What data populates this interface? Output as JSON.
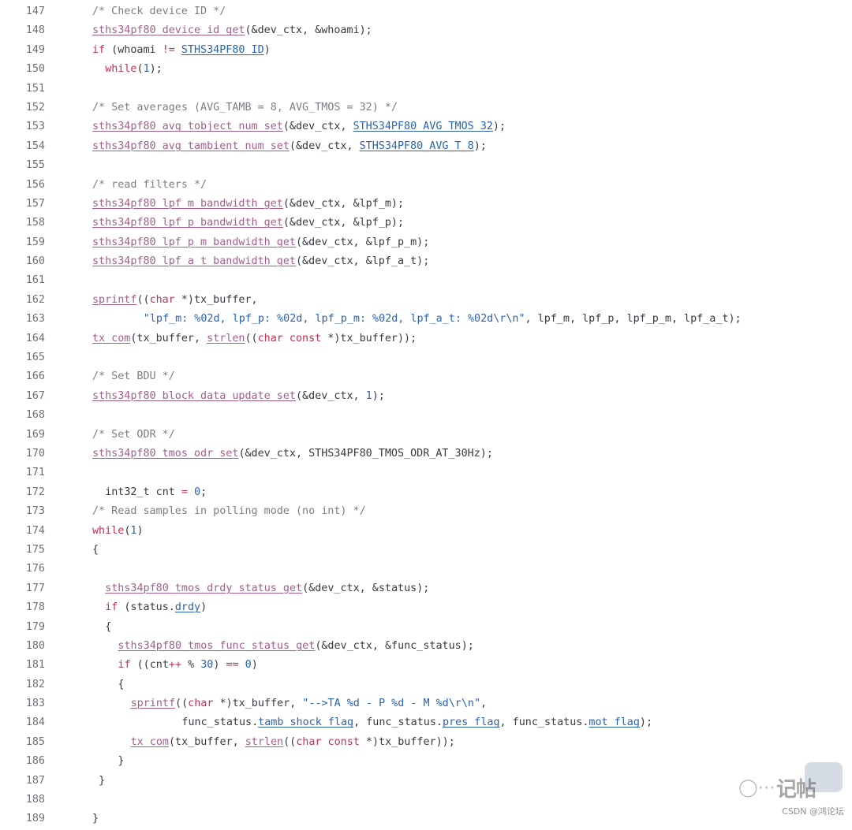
{
  "lines": [
    {
      "n": "147",
      "indent": 0,
      "tokens": [
        {
          "t": "/* Check device ID */",
          "c": "cm"
        }
      ]
    },
    {
      "n": "148",
      "indent": 0,
      "tokens": [
        {
          "t": "sths34pf80_device_id_get",
          "c": "fn"
        },
        {
          "t": "(&dev_ctx, &whoami);",
          "c": "id"
        }
      ]
    },
    {
      "n": "149",
      "indent": 0,
      "tokens": [
        {
          "t": "if",
          "c": "kw"
        },
        {
          "t": " (whoami ",
          "c": "id"
        },
        {
          "t": "!=",
          "c": "kw"
        },
        {
          "t": " ",
          "c": "id"
        },
        {
          "t": "STHS34PF80_ID",
          "c": "mac"
        },
        {
          "t": ")",
          "c": "id"
        }
      ]
    },
    {
      "n": "150",
      "indent": 2,
      "tokens": [
        {
          "t": "while",
          "c": "kw"
        },
        {
          "t": "(",
          "c": "id"
        },
        {
          "t": "1",
          "c": "num"
        },
        {
          "t": ");",
          "c": "id"
        }
      ]
    },
    {
      "n": "151",
      "indent": 0,
      "tokens": []
    },
    {
      "n": "152",
      "indent": 0,
      "tokens": [
        {
          "t": "/* Set averages (AVG_TAMB = 8, AVG_TMOS = 32) */",
          "c": "cm"
        }
      ]
    },
    {
      "n": "153",
      "indent": 0,
      "tokens": [
        {
          "t": "sths34pf80_avg_tobject_num_set",
          "c": "fn"
        },
        {
          "t": "(&dev_ctx, ",
          "c": "id"
        },
        {
          "t": "STHS34PF80_AVG_TMOS_32",
          "c": "mac"
        },
        {
          "t": ");",
          "c": "id"
        }
      ]
    },
    {
      "n": "154",
      "indent": 0,
      "tokens": [
        {
          "t": "sths34pf80_avg_tambient_num_set",
          "c": "fn"
        },
        {
          "t": "(&dev_ctx, ",
          "c": "id"
        },
        {
          "t": "STHS34PF80_AVG_T_8",
          "c": "mac"
        },
        {
          "t": ");",
          "c": "id"
        }
      ]
    },
    {
      "n": "155",
      "indent": 0,
      "tokens": []
    },
    {
      "n": "156",
      "indent": 0,
      "tokens": [
        {
          "t": "/* read filters */",
          "c": "cm"
        }
      ]
    },
    {
      "n": "157",
      "indent": 0,
      "tokens": [
        {
          "t": "sths34pf80_lpf_m_bandwidth_get",
          "c": "fn"
        },
        {
          "t": "(&dev_ctx, &lpf_m);",
          "c": "id"
        }
      ]
    },
    {
      "n": "158",
      "indent": 0,
      "tokens": [
        {
          "t": "sths34pf80_lpf_p_bandwidth_get",
          "c": "fn"
        },
        {
          "t": "(&dev_ctx, &lpf_p);",
          "c": "id"
        }
      ]
    },
    {
      "n": "159",
      "indent": 0,
      "tokens": [
        {
          "t": "sths34pf80_lpf_p_m_bandwidth_get",
          "c": "fn"
        },
        {
          "t": "(&dev_ctx, &lpf_p_m);",
          "c": "id"
        }
      ]
    },
    {
      "n": "160",
      "indent": 0,
      "tokens": [
        {
          "t": "sths34pf80_lpf_a_t_bandwidth_get",
          "c": "fn"
        },
        {
          "t": "(&dev_ctx, &lpf_a_t);",
          "c": "id"
        }
      ]
    },
    {
      "n": "161",
      "indent": 0,
      "tokens": []
    },
    {
      "n": "162",
      "indent": 0,
      "tokens": [
        {
          "t": "sprintf",
          "c": "fn"
        },
        {
          "t": "((",
          "c": "id"
        },
        {
          "t": "char",
          "c": "kw"
        },
        {
          "t": " *)tx_buffer,",
          "c": "id"
        }
      ]
    },
    {
      "n": "163",
      "indent": 8,
      "tokens": [
        {
          "t": "\"lpf_m: %02d, lpf_p: %02d, lpf_p_m: %02d, lpf_a_t: %02d\\r\\n\"",
          "c": "str"
        },
        {
          "t": ", lpf_m, lpf_p, lpf_p_m, lpf_a_t);",
          "c": "id"
        }
      ]
    },
    {
      "n": "164",
      "indent": 0,
      "tokens": [
        {
          "t": "tx_com",
          "c": "fn"
        },
        {
          "t": "(tx_buffer, ",
          "c": "id"
        },
        {
          "t": "strlen",
          "c": "fn"
        },
        {
          "t": "((",
          "c": "id"
        },
        {
          "t": "char const",
          "c": "kw"
        },
        {
          "t": " *)tx_buffer));",
          "c": "id"
        }
      ]
    },
    {
      "n": "165",
      "indent": 0,
      "tokens": []
    },
    {
      "n": "166",
      "indent": 0,
      "tokens": [
        {
          "t": "/* Set BDU */",
          "c": "cm"
        }
      ]
    },
    {
      "n": "167",
      "indent": 0,
      "tokens": [
        {
          "t": "sths34pf80_block_data_update_set",
          "c": "fn"
        },
        {
          "t": "(&dev_ctx, ",
          "c": "id"
        },
        {
          "t": "1",
          "c": "num"
        },
        {
          "t": ");",
          "c": "id"
        }
      ]
    },
    {
      "n": "168",
      "indent": 0,
      "tokens": []
    },
    {
      "n": "169",
      "indent": 0,
      "tokens": [
        {
          "t": "/* Set ODR */",
          "c": "cm"
        }
      ]
    },
    {
      "n": "170",
      "indent": 0,
      "tokens": [
        {
          "t": "sths34pf80_tmos_odr_set",
          "c": "fn"
        },
        {
          "t": "(&dev_ctx, STHS34PF80_TMOS_ODR_AT_30Hz);",
          "c": "id"
        }
      ]
    },
    {
      "n": "171",
      "indent": 0,
      "tokens": []
    },
    {
      "n": "172",
      "indent": 2,
      "tokens": [
        {
          "t": "int32_t cnt ",
          "c": "id"
        },
        {
          "t": "=",
          "c": "kw"
        },
        {
          "t": " ",
          "c": "id"
        },
        {
          "t": "0",
          "c": "num"
        },
        {
          "t": ";",
          "c": "id"
        }
      ]
    },
    {
      "n": "173",
      "indent": 0,
      "tokens": [
        {
          "t": "/* Read samples in polling mode (no int) */",
          "c": "cm"
        }
      ]
    },
    {
      "n": "174",
      "indent": 0,
      "tokens": [
        {
          "t": "while",
          "c": "kw"
        },
        {
          "t": "(",
          "c": "id"
        },
        {
          "t": "1",
          "c": "num"
        },
        {
          "t": ")",
          "c": "id"
        }
      ]
    },
    {
      "n": "175",
      "indent": 0,
      "tokens": [
        {
          "t": "{",
          "c": "id"
        }
      ]
    },
    {
      "n": "176",
      "indent": 0,
      "tokens": []
    },
    {
      "n": "177",
      "indent": 2,
      "tokens": [
        {
          "t": "sths34pf80_tmos_drdy_status_get",
          "c": "fn"
        },
        {
          "t": "(&dev_ctx, &status);",
          "c": "id"
        }
      ]
    },
    {
      "n": "178",
      "indent": 2,
      "tokens": [
        {
          "t": "if",
          "c": "kw"
        },
        {
          "t": " (status.",
          "c": "id"
        },
        {
          "t": "drdy",
          "c": "fld"
        },
        {
          "t": ")",
          "c": "id"
        }
      ]
    },
    {
      "n": "179",
      "indent": 2,
      "tokens": [
        {
          "t": "{",
          "c": "id"
        }
      ]
    },
    {
      "n": "180",
      "indent": 4,
      "tokens": [
        {
          "t": "sths34pf80_tmos_func_status_get",
          "c": "fn"
        },
        {
          "t": "(&dev_ctx, &func_status);",
          "c": "id"
        }
      ]
    },
    {
      "n": "181",
      "indent": 4,
      "tokens": [
        {
          "t": "if",
          "c": "kw"
        },
        {
          "t": " ((cnt",
          "c": "id"
        },
        {
          "t": "++",
          "c": "kw"
        },
        {
          "t": " % ",
          "c": "id"
        },
        {
          "t": "30",
          "c": "num"
        },
        {
          "t": ") ",
          "c": "id"
        },
        {
          "t": "==",
          "c": "kw"
        },
        {
          "t": " ",
          "c": "id"
        },
        {
          "t": "0",
          "c": "num"
        },
        {
          "t": ")",
          "c": "id"
        }
      ]
    },
    {
      "n": "182",
      "indent": 4,
      "tokens": [
        {
          "t": "{",
          "c": "id"
        }
      ]
    },
    {
      "n": "183",
      "indent": 6,
      "tokens": [
        {
          "t": "sprintf",
          "c": "fn"
        },
        {
          "t": "((",
          "c": "id"
        },
        {
          "t": "char",
          "c": "kw"
        },
        {
          "t": " *)tx_buffer, ",
          "c": "id"
        },
        {
          "t": "\"-->TA %d - P %d - M %d\\r\\n\"",
          "c": "str"
        },
        {
          "t": ",",
          "c": "id"
        }
      ]
    },
    {
      "n": "184",
      "indent": 14,
      "tokens": [
        {
          "t": "func_status.",
          "c": "id"
        },
        {
          "t": "tamb_shock_flag",
          "c": "fld"
        },
        {
          "t": ", func_status.",
          "c": "id"
        },
        {
          "t": "pres_flag",
          "c": "fld"
        },
        {
          "t": ", func_status.",
          "c": "id"
        },
        {
          "t": "mot_flag",
          "c": "fld"
        },
        {
          "t": ");",
          "c": "id"
        }
      ]
    },
    {
      "n": "185",
      "indent": 6,
      "tokens": [
        {
          "t": "tx_com",
          "c": "fn"
        },
        {
          "t": "(tx_buffer, ",
          "c": "id"
        },
        {
          "t": "strlen",
          "c": "fn"
        },
        {
          "t": "((",
          "c": "id"
        },
        {
          "t": "char const",
          "c": "kw"
        },
        {
          "t": " *)tx_buffer));",
          "c": "id"
        }
      ]
    },
    {
      "n": "186",
      "indent": 4,
      "tokens": [
        {
          "t": "}",
          "c": "id"
        }
      ]
    },
    {
      "n": "187",
      "indent": 1,
      "tokens": [
        {
          "t": "}",
          "c": "id"
        }
      ]
    },
    {
      "n": "188",
      "indent": 0,
      "tokens": []
    },
    {
      "n": "189",
      "indent": 0,
      "tokens": [
        {
          "t": "}",
          "c": "id"
        }
      ]
    }
  ],
  "watermark": {
    "icon": "wechat-icon",
    "title": "记帖",
    "caption": "CSDN @鸿论坛"
  }
}
